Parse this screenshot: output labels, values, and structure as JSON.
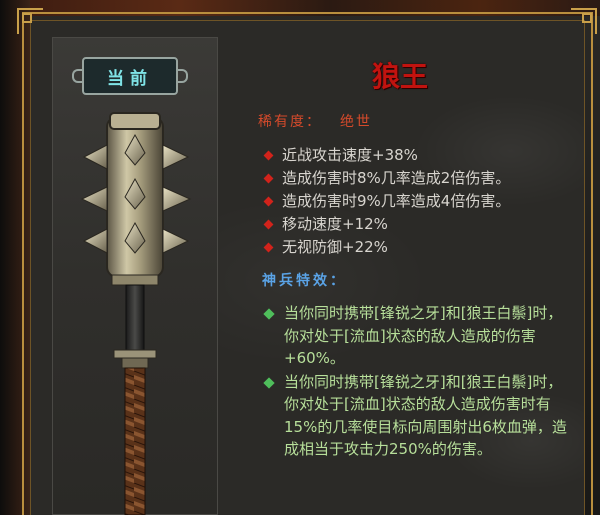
{
  "panel": {
    "current_label": "当前",
    "item_name": "狼王",
    "rarity_label": "稀有度：",
    "rarity_value": "绝世"
  },
  "stats": [
    {
      "text": "近战攻击速度+38%"
    },
    {
      "text": "造成伤害时8%几率造成2倍伤害。"
    },
    {
      "text": "造成伤害时9%几率造成4倍伤害。"
    },
    {
      "text": "移动速度+12%"
    },
    {
      "text": "无视防御+22%"
    }
  ],
  "special": {
    "title": "神兵特效：",
    "effects": [
      {
        "text": "当你同时携带[锋锐之牙]和[狼王白鬃]时，你对处于[流血]状态的敌人造成的伤害+60%。"
      },
      {
        "text": "当你同时携带[锋锐之牙]和[狼王白鬃]时，你对处于[流血]状态的敌人造成伤害时有15%的几率使目标向周围射出6枚血弹，造成相当于攻击力250%的伤害。"
      }
    ]
  },
  "colors": {
    "title_red": "#c1130f",
    "rarity_red": "#d44a2b",
    "stat_diamond": "#d2231b",
    "special_title_blue": "#5aa3e6",
    "special_text_green": "#b7df9a",
    "special_diamond": "#4fbe5b",
    "current_tag_cyan": "#7fe3e6",
    "frame_gold": "#b98f3e"
  },
  "icons": {
    "weapon": "spiked-mace-icon",
    "stat_bullet": "red-diamond-icon",
    "special_bullet": "green-diamond-icon"
  }
}
